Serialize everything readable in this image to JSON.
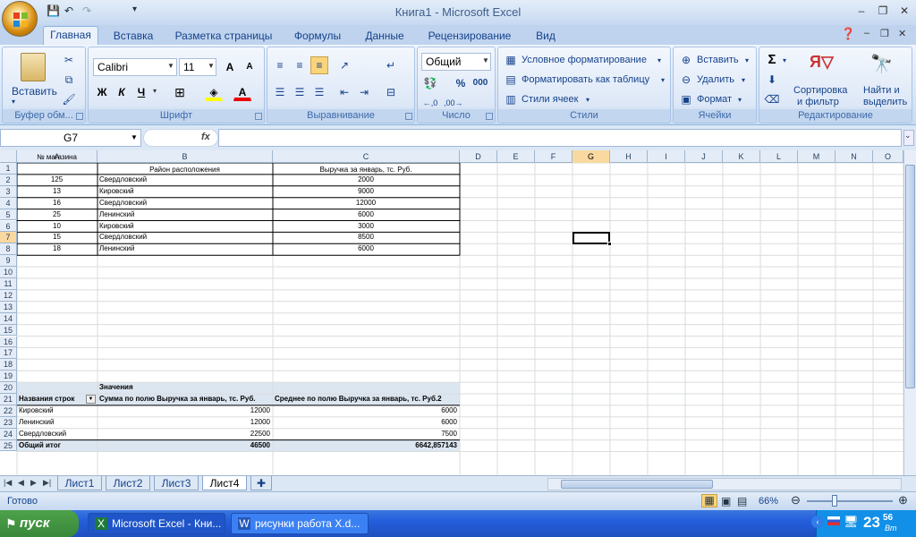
{
  "window": {
    "title": "Книга1 - Microsoft Excel"
  },
  "ribbon_tabs": [
    "Главная",
    "Вставка",
    "Разметка страницы",
    "Формулы",
    "Данные",
    "Рецензирование",
    "Вид"
  ],
  "ribbon": {
    "clipboard": {
      "paste": "Вставить",
      "label": "Буфер обм..."
    },
    "font": {
      "name": "Calibri",
      "size": "11",
      "bold": "Ж",
      "italic": "К",
      "underline": "Ч",
      "label": "Шрифт",
      "grow": "A",
      "shrink": "A",
      "fontcolor": "A"
    },
    "alignment": {
      "label": "Выравнивание"
    },
    "number": {
      "format": "Общий",
      "label": "Число",
      "percent": "%",
      "thousands": "000"
    },
    "styles": {
      "cond": "Условное форматирование",
      "table": "Форматировать как таблицу",
      "cell": "Стили ячеек",
      "label": "Стили"
    },
    "cells": {
      "insert": "Вставить",
      "delete": "Удалить",
      "format": "Формат",
      "label": "Ячейки"
    },
    "editing": {
      "sort": "Сортировка",
      "sort2": "и фильтр",
      "find": "Найти и",
      "find2": "выделить",
      "label": "Редактирование",
      "sigma": "Σ"
    }
  },
  "formula_bar": {
    "namebox": "G7",
    "fx": "fx",
    "value": ""
  },
  "columns": [
    "A",
    "B",
    "C",
    "D",
    "E",
    "F",
    "G",
    "H",
    "I",
    "J",
    "K",
    "L",
    "M",
    "N",
    "O"
  ],
  "rows": [
    "1",
    "2",
    "3",
    "4",
    "5",
    "6",
    "7",
    "8",
    "9",
    "10",
    "11",
    "12",
    "13",
    "14",
    "15",
    "16",
    "17",
    "18",
    "19",
    "20",
    "21",
    "22",
    "23",
    "24",
    "25"
  ],
  "table": {
    "headers": [
      "№ магазина",
      "Район расположения",
      "Выручка за январь, тс. Руб."
    ],
    "rows": [
      [
        "125",
        "Свердловский",
        "2000"
      ],
      [
        "13",
        "Кировский",
        "9000"
      ],
      [
        "16",
        "Свердловский",
        "12000"
      ],
      [
        "25",
        "Ленинский",
        "6000"
      ],
      [
        "10",
        "Кировский",
        "3000"
      ],
      [
        "15",
        "Свердловский",
        "8500"
      ],
      [
        "18",
        "Ленинский",
        "6000"
      ]
    ]
  },
  "pivot": {
    "values_label": "Значения",
    "row_label": "Названия строк",
    "col1": "Сумма по полю Выручка за январь, тс. Руб.",
    "col2": "Среднее по полю Выручка за январь, тс. Руб.2",
    "rows": [
      [
        "Кировский",
        "12000",
        "6000"
      ],
      [
        "Ленинский",
        "12000",
        "6000"
      ],
      [
        "Свердловский",
        "22500",
        "7500"
      ]
    ],
    "total": [
      "Общий итог",
      "46500",
      "6642,857143"
    ]
  },
  "sheets": [
    "Лист1",
    "Лист2",
    "Лист3",
    "Лист4"
  ],
  "status": {
    "ready": "Готово",
    "zoom": "66%"
  },
  "taskbar": {
    "start": "пуск",
    "tasks": [
      "Microsoft Excel - Кни...",
      "рисунки работа X.d..."
    ],
    "clock": "23",
    "clock2": "56",
    "clock3": "Вт"
  }
}
